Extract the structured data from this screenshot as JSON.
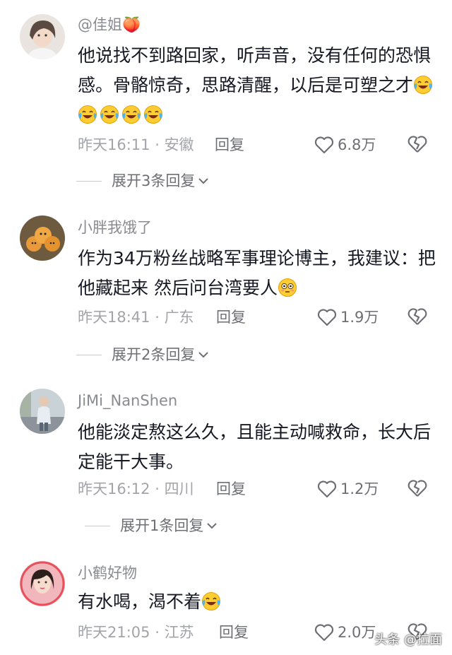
{
  "comments": [
    {
      "username": "@佳姐🍑",
      "text": "他说找不到路回家，听声音，没有任何的恐惧感。骨骼惊奇，思路清醒，以后是可塑之才",
      "emoji_count": 5,
      "time": "昨天16:11",
      "location": "安徽",
      "reply_label": "回复",
      "likes": "6.8万",
      "expand_label": "展开3条回复"
    },
    {
      "username": "小胖我饿了",
      "text": "作为34万粉丝战略军事理论博主，我建议：把他藏起来 然后问台湾要人",
      "emoji_count": 1,
      "time": "昨天18:41",
      "location": "广东",
      "reply_label": "回复",
      "likes": "1.9万",
      "expand_label": "展开2条回复"
    },
    {
      "username": "JiMi_NanShen",
      "text": "他能淡定熬这么久，且能主动喊救命，长大后定能干大事。",
      "emoji_count": 0,
      "time": "昨天16:12",
      "location": "四川",
      "reply_label": "回复",
      "likes": "1.2万",
      "expand_label": "展开1条回复"
    },
    {
      "username": "小鹤好物",
      "text": "有水喝，渴不着",
      "emoji_count": 1,
      "time": "昨天21:05",
      "location": "江苏",
      "reply_label": "回复",
      "likes": "2.0万",
      "expand_label": ""
    }
  ],
  "separator": " · ",
  "watermark": "头条 @拉面",
  "icons": [
    "heart-icon",
    "broken-heart-icon",
    "chevron-down-icon",
    "laughing-crying-emoji",
    "flushed-face-emoji"
  ]
}
